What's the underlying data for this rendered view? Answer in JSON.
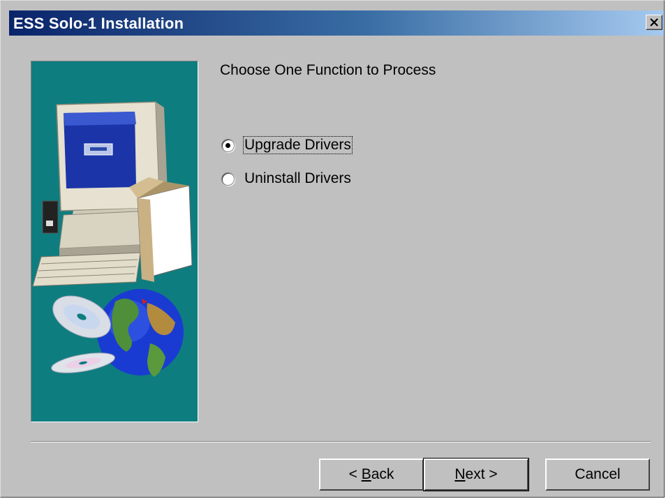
{
  "window": {
    "title": "ESS Solo-1 Installation"
  },
  "main": {
    "prompt": "Choose One Function to Process",
    "options": [
      {
        "label": "Upgrade Drivers",
        "selected": true
      },
      {
        "label": "Uninstall Drivers",
        "selected": false
      }
    ]
  },
  "buttons": {
    "back_prefix": "< ",
    "back_mnemonic": "B",
    "back_rest": "ack",
    "next_mnemonic": "N",
    "next_rest": "ext >",
    "cancel": "Cancel"
  },
  "colors": {
    "dialog_bg": "#c0c0c0",
    "title_gradient_start": "#0a246a",
    "title_gradient_end": "#a6caf0",
    "illustration_bg": "#0e7d80"
  }
}
